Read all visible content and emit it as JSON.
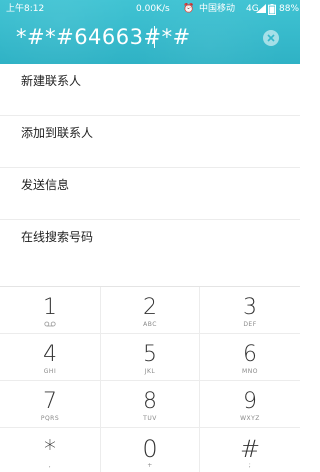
{
  "status_bar": {
    "time": "上午8:12",
    "speed": "0.00K/s",
    "carrier": "中国移动",
    "network": "4G",
    "battery": "88%"
  },
  "dialer": {
    "number": "*#*#64663#*#",
    "clear_icon": "clear-circle-icon"
  },
  "menu": {
    "items": [
      {
        "label": "新建联系人"
      },
      {
        "label": "添加到联系人"
      },
      {
        "label": "发送信息"
      },
      {
        "label": "在线搜索号码"
      }
    ]
  },
  "keypad": {
    "keys": [
      {
        "digit": "1",
        "sub": "voicemail-icon"
      },
      {
        "digit": "2",
        "sub": "ABC"
      },
      {
        "digit": "3",
        "sub": "DEF"
      },
      {
        "digit": "4",
        "sub": "GHI"
      },
      {
        "digit": "5",
        "sub": "JKL"
      },
      {
        "digit": "6",
        "sub": "MNO"
      },
      {
        "digit": "7",
        "sub": "PQRS"
      },
      {
        "digit": "8",
        "sub": "TUV"
      },
      {
        "digit": "9",
        "sub": "WXYZ"
      },
      {
        "digit": "*",
        "sub": ","
      },
      {
        "digit": "0",
        "sub": "+"
      },
      {
        "digit": "#",
        "sub": ";"
      }
    ]
  },
  "colors": {
    "header": "#34b8ca",
    "text": "#222222",
    "divider": "#ececec"
  }
}
